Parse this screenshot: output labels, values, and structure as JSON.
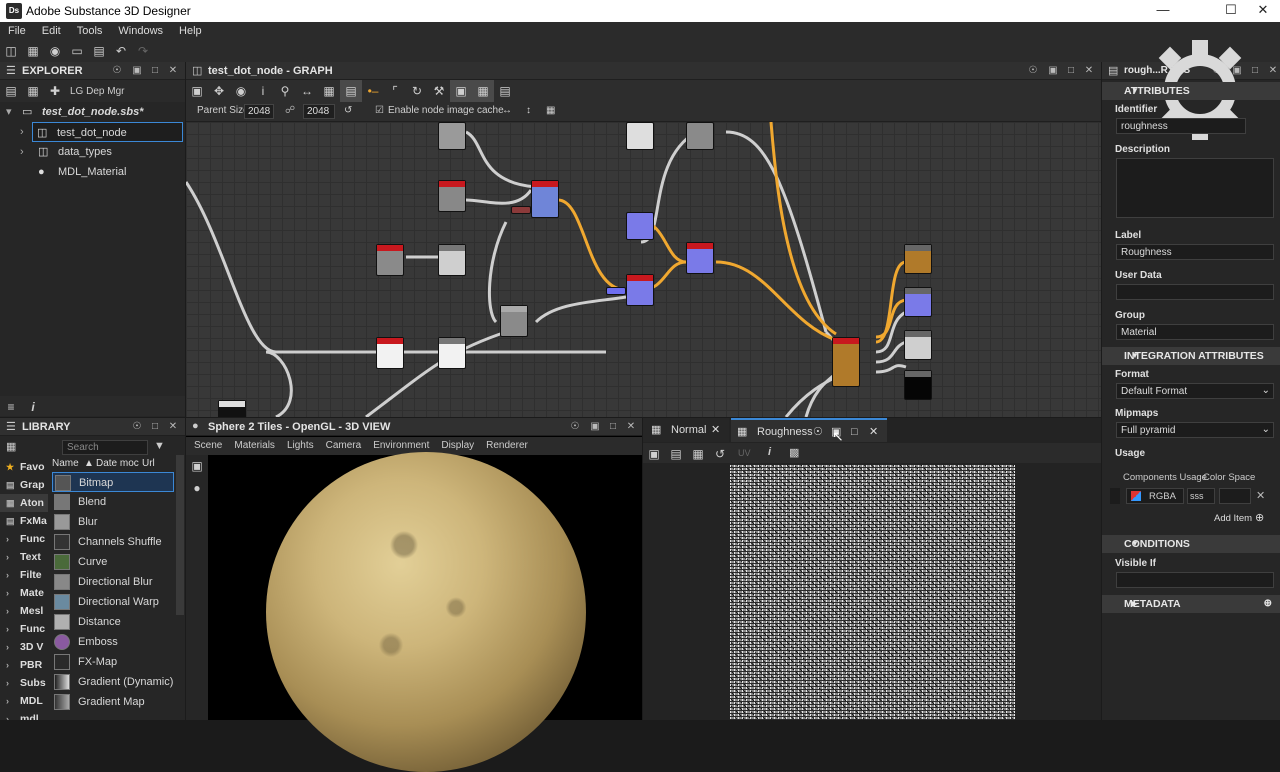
{
  "window": {
    "title": "Adobe Substance 3D Designer",
    "app_icon": "Ds"
  },
  "menu": [
    "File",
    "Edit",
    "Tools",
    "Windows",
    "Help"
  ],
  "toolbar": {
    "lg_dep_mgr": "LG Dep Mgr"
  },
  "explorer": {
    "title": "EXPLORER",
    "package": "test_dot_node.sbs*",
    "items": [
      "test_dot_node",
      "data_types",
      "MDL_Material"
    ]
  },
  "graph": {
    "title": "test_dot_node - GRAPH",
    "parent_size_label": "Parent Size:",
    "parent_size_w": "2048",
    "parent_size_h": "2048",
    "cache_label": "Enable node image cache"
  },
  "properties": {
    "title": "rough...RTIES",
    "attributes_header": "ATTRIBUTES",
    "identifier_label": "Identifier",
    "identifier_value": "roughness",
    "description_label": "Description",
    "label_label": "Label",
    "label_value": "Roughness",
    "user_data_label": "User Data",
    "group_label": "Group",
    "group_value": "Material",
    "integration_header": "INTEGRATION ATTRIBUTES",
    "format_label": "Format",
    "format_value": "Default Format",
    "mipmaps_label": "Mipmaps",
    "mipmaps_value": "Full pyramid",
    "usage_label": "Usage",
    "components_usage_label": "Components Usage",
    "color_space_label": "Color Space",
    "components_value": "RGBA",
    "color_space_value": "sss",
    "add_item": "Add Item",
    "conditions_header": "CONDITIONS",
    "visible_if_label": "Visible If",
    "metadata_header": "METADATA"
  },
  "library": {
    "title": "LIBRARY",
    "search_placeholder": "Search",
    "columns": [
      "Name",
      "Date moc",
      "Url"
    ],
    "categories": [
      "Favo",
      "Grap",
      "Aton",
      "FxMa",
      "Func",
      "Text",
      "Filte",
      "Mate",
      "Mesl",
      "Func",
      "3D V",
      "PBR",
      "Subs",
      "MDL",
      "mdl"
    ],
    "items": [
      "Bitmap",
      "Blend",
      "Blur",
      "Channels Shuffle",
      "Curve",
      "Directional Blur",
      "Directional Warp",
      "Distance",
      "Emboss",
      "FX-Map",
      "Gradient (Dynamic)",
      "Gradient Map"
    ]
  },
  "view3d": {
    "title": "Sphere 2 Tiles - OpenGL - 3D VIEW",
    "menu": [
      "Scene",
      "Materials",
      "Lights",
      "Camera",
      "Environment",
      "Display",
      "Renderer"
    ]
  },
  "view2d": {
    "tabs": [
      "Normal",
      "Roughness"
    ],
    "uv_label": "UV"
  },
  "colors": {
    "accent": "#3b88d6",
    "wire_orange": "#f0a830",
    "node_red": "#c8181e"
  }
}
